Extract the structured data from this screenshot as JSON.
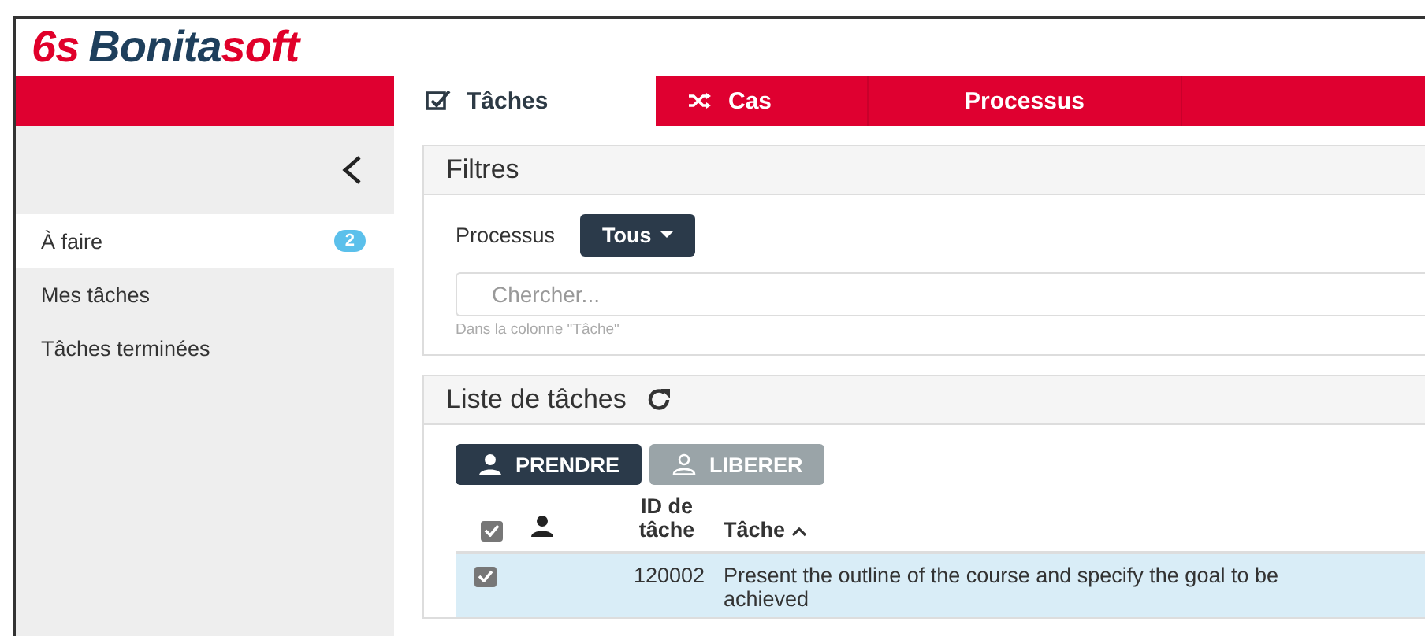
{
  "logo": {
    "mark": "6s",
    "brand": "Bonita",
    "brand_accent": "soft"
  },
  "tabs": [
    {
      "label": "Tâches",
      "selected": true
    },
    {
      "label": "Cas",
      "selected": false
    },
    {
      "label": "Processus",
      "selected": false
    }
  ],
  "sidebar": {
    "items": [
      {
        "label": "À faire",
        "badge": "2",
        "selected": true
      },
      {
        "label": "Mes tâches",
        "selected": false
      },
      {
        "label": "Tâches terminées",
        "selected": false
      }
    ]
  },
  "filters": {
    "title": "Filtres",
    "process_label": "Processus",
    "process_value": "Tous",
    "search": {
      "placeholder": "Chercher...",
      "hint": "Dans la colonne \"Tâche\""
    }
  },
  "task_list": {
    "title": "Liste de tâches",
    "buttons": [
      {
        "label": "PRENDRE",
        "disabled": false
      },
      {
        "label": "LIBERER",
        "disabled": true
      }
    ],
    "all_checked": true,
    "columns": [
      "ID de tâche",
      "Tâche"
    ],
    "rows": [
      {
        "checked": true,
        "selected": true,
        "id": "120002",
        "task": "Present the outline of the course and specify the goal to be achieved"
      }
    ]
  }
}
